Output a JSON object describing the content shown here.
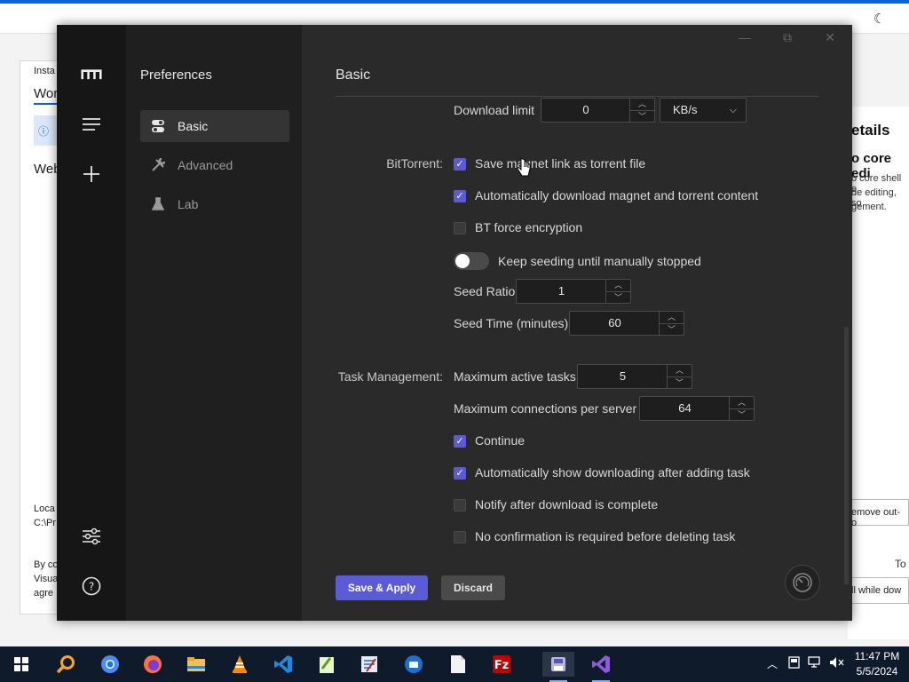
{
  "background_app": {
    "left_texts": [
      "Insta",
      "Wor",
      "Web",
      "Loca",
      "C:\\Pr",
      "By co",
      "Visua",
      "agre"
    ],
    "right_panel": {
      "title": "etails",
      "subtitle": "o core edi",
      "lines": [
        "o core shell e",
        "de editing, so",
        "gement."
      ],
      "option": "emove out-o",
      "total": "To",
      "install_option": "ll while dow"
    }
  },
  "window": {
    "controls": {
      "minimize": "—",
      "maximize": "⧉",
      "close": "✕"
    }
  },
  "rail": {
    "icons": [
      "motrix-logo-icon",
      "menu-icon",
      "add-icon",
      "preferences-icon",
      "help-icon"
    ]
  },
  "sidebar": {
    "title": "Preferences",
    "items": [
      {
        "label": "Basic",
        "icon": "toggles-icon",
        "active": true
      },
      {
        "label": "Advanced",
        "icon": "tools-icon",
        "active": false
      },
      {
        "label": "Lab",
        "icon": "flask-icon",
        "active": false
      }
    ]
  },
  "main": {
    "heading": "Basic",
    "download_limit": {
      "label": "Download limit",
      "value": "0",
      "unit": "KB/s"
    },
    "bittorrent": {
      "section_label": "BitTorrent:",
      "options": [
        {
          "label": "Save magnet link as torrent file",
          "checked": true
        },
        {
          "label": "Automatically download magnet and torrent content",
          "checked": true
        },
        {
          "label": "BT force encryption",
          "checked": false
        }
      ],
      "keep_seeding": {
        "label": "Keep seeding until manually stopped",
        "on": false
      },
      "seed_ratio": {
        "label": "Seed Ratio",
        "value": "1"
      },
      "seed_time": {
        "label": "Seed Time (minutes)",
        "value": "60"
      }
    },
    "task_management": {
      "section_label": "Task Management:",
      "max_active": {
        "label": "Maximum active tasks",
        "value": "5"
      },
      "max_connections": {
        "label": "Maximum connections per server",
        "value": "64"
      },
      "options": [
        {
          "label": "Continue",
          "checked": true
        },
        {
          "label": "Automatically show downloading after adding task",
          "checked": true
        },
        {
          "label": "Notify after download is complete",
          "checked": false
        },
        {
          "label": "No confirmation is required before deleting task",
          "checked": false
        }
      ]
    },
    "buttons": {
      "save": "Save & Apply",
      "discard": "Discard"
    }
  },
  "taskbar": {
    "apps": [
      "windows-start-icon",
      "search-icon",
      "chrome-icon",
      "firefox-icon",
      "file-explorer-icon",
      "vlc-icon",
      "vscode-icon",
      "notepad-plus-icon",
      "text-editor-icon",
      "thunderbird-icon",
      "notepad-icon",
      "filezilla-icon",
      "motrix-icon",
      "visual-studio-icon"
    ],
    "time": "11:47 PM",
    "date": "5/5/2024"
  },
  "colors": {
    "accent": "#5b5bd6",
    "rail": "#161616",
    "sidebar": "#1f1f1f",
    "main": "#2a2a2a",
    "taskbar": "#0f1a2b"
  }
}
